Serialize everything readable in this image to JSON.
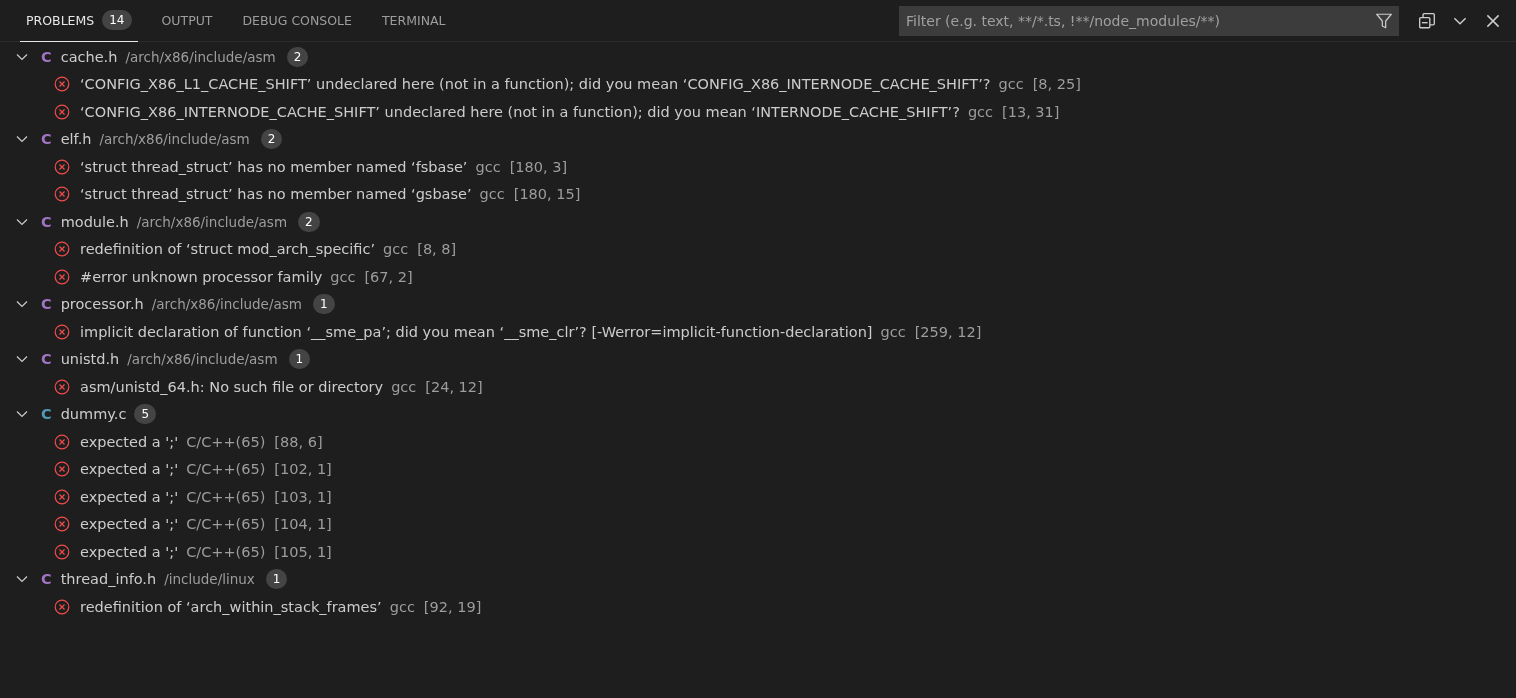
{
  "tabs": [
    {
      "label": "PROBLEMS",
      "selected": true,
      "badge": "14"
    },
    {
      "label": "OUTPUT",
      "selected": false
    },
    {
      "label": "DEBUG CONSOLE",
      "selected": false
    },
    {
      "label": "TERMINAL",
      "selected": false
    }
  ],
  "filter": {
    "placeholder": "Filter (e.g. text, **/*.ts, !**/node_modules/**)"
  },
  "files": [
    {
      "icon_letter": "C",
      "color": "#a074c4",
      "name": "cache.h",
      "path": "/arch/x86/include/asm",
      "count": "2",
      "expanded": true,
      "problems": [
        {
          "message": "‘CONFIG_X86_L1_CACHE_SHIFT’ undeclared here (not in a function); did you mean ‘CONFIG_X86_INTERNODE_CACHE_SHIFT’?",
          "source": "gcc",
          "location": "[8, 25]"
        },
        {
          "message": "‘CONFIG_X86_INTERNODE_CACHE_SHIFT’ undeclared here (not in a function); did you mean ‘INTERNODE_CACHE_SHIFT’?",
          "source": "gcc",
          "location": "[13, 31]"
        }
      ]
    },
    {
      "icon_letter": "C",
      "color": "#a074c4",
      "name": "elf.h",
      "path": "/arch/x86/include/asm",
      "count": "2",
      "expanded": true,
      "problems": [
        {
          "message": "‘struct thread_struct’ has no member named ‘fsbase’",
          "source": "gcc",
          "location": "[180, 3]"
        },
        {
          "message": "‘struct thread_struct’ has no member named ‘gsbase’",
          "source": "gcc",
          "location": "[180, 15]"
        }
      ]
    },
    {
      "icon_letter": "C",
      "color": "#a074c4",
      "name": "module.h",
      "path": "/arch/x86/include/asm",
      "count": "2",
      "expanded": true,
      "problems": [
        {
          "message": "redefinition of ‘struct mod_arch_specific’",
          "source": "gcc",
          "location": "[8, 8]"
        },
        {
          "message": "#error unknown processor family",
          "source": "gcc",
          "location": "[67, 2]"
        }
      ]
    },
    {
      "icon_letter": "C",
      "color": "#a074c4",
      "name": "processor.h",
      "path": "/arch/x86/include/asm",
      "count": "1",
      "expanded": true,
      "problems": [
        {
          "message": "implicit declaration of function ‘__sme_pa’; did you mean ‘__sme_clr’? [-Werror=implicit-function-declaration]",
          "source": "gcc",
          "location": "[259, 12]"
        }
      ]
    },
    {
      "icon_letter": "C",
      "color": "#a074c4",
      "name": "unistd.h",
      "path": "/arch/x86/include/asm",
      "count": "1",
      "expanded": true,
      "problems": [
        {
          "message": "asm/unistd_64.h: No such file or directory",
          "source": "gcc",
          "location": "[24, 12]"
        }
      ]
    },
    {
      "icon_letter": "C",
      "color": "#519aba",
      "name": "dummy.c",
      "count": "5",
      "expanded": true,
      "problems": [
        {
          "message": "expected a ';'",
          "source": "C/C++(65)",
          "location": "[88, 6]"
        },
        {
          "message": "expected a ';'",
          "source": "C/C++(65)",
          "location": "[102, 1]"
        },
        {
          "message": "expected a ';'",
          "source": "C/C++(65)",
          "location": "[103, 1]"
        },
        {
          "message": "expected a ';'",
          "source": "C/C++(65)",
          "location": "[104, 1]"
        },
        {
          "message": "expected a ';'",
          "source": "C/C++(65)",
          "location": "[105, 1]"
        }
      ]
    },
    {
      "icon_letter": "C",
      "color": "#a074c4",
      "name": "thread_info.h",
      "path": "/include/linux",
      "count": "1",
      "expanded": true,
      "problems": [
        {
          "message": "redefinition of ‘arch_within_stack_frames’",
          "source": "gcc",
          "location": "[92, 19]"
        }
      ]
    }
  ]
}
